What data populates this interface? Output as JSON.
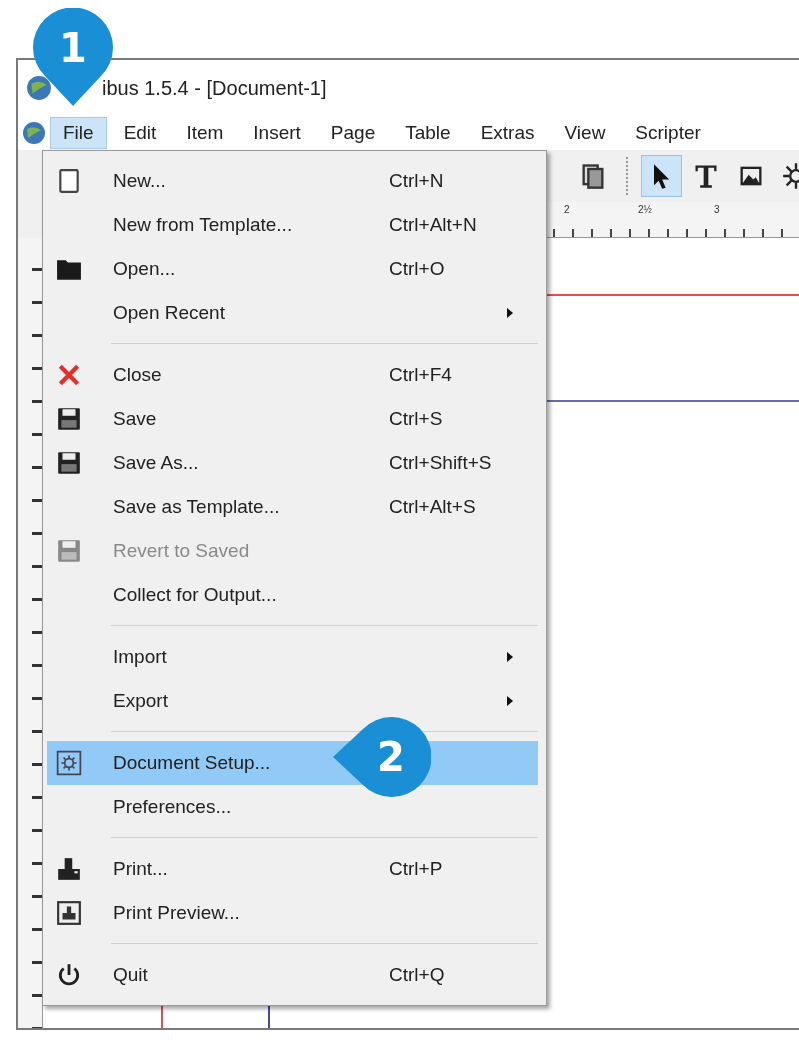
{
  "window": {
    "title": "ibus 1.5.4 - [Document-1]"
  },
  "menu_bar": [
    {
      "label": "File",
      "selected": true
    },
    {
      "label": "Edit",
      "selected": false
    },
    {
      "label": "Item",
      "selected": false
    },
    {
      "label": "Insert",
      "selected": false
    },
    {
      "label": "Page",
      "selected": false
    },
    {
      "label": "Table",
      "selected": false
    },
    {
      "label": "Extras",
      "selected": false
    },
    {
      "label": "View",
      "selected": false
    },
    {
      "label": "Scripter",
      "selected": false
    }
  ],
  "toolbar": [
    {
      "kind": "pages",
      "selected": false
    },
    {
      "kind": "pointer",
      "selected": true
    },
    {
      "kind": "text",
      "selected": false
    },
    {
      "kind": "image",
      "selected": false
    },
    {
      "kind": "shape",
      "selected": false
    }
  ],
  "ruler": {
    "labels": [
      "2",
      "2½",
      "3"
    ]
  },
  "file_menu": [
    [
      {
        "label": "New...",
        "shortcut": "Ctrl+N",
        "kind": "page",
        "submenu": false,
        "disabled": false,
        "selected": false
      },
      {
        "label": "New from Template...",
        "shortcut": "Ctrl+Alt+N",
        "kind": "none",
        "submenu": false,
        "disabled": false,
        "selected": false
      },
      {
        "label": "Open...",
        "shortcut": "Ctrl+O",
        "kind": "folder",
        "submenu": false,
        "disabled": false,
        "selected": false
      },
      {
        "label": "Open Recent",
        "kind": "none",
        "submenu": true,
        "disabled": false,
        "selected": false
      }
    ],
    [
      {
        "label": "Close",
        "shortcut": "Ctrl+F4",
        "kind": "cross",
        "submenu": false,
        "disabled": false,
        "selected": false
      },
      {
        "label": "Save",
        "shortcut": "Ctrl+S",
        "kind": "disk",
        "submenu": false,
        "disabled": false,
        "selected": false
      },
      {
        "label": "Save As...",
        "shortcut": "Ctrl+Shift+S",
        "kind": "disk",
        "submenu": false,
        "disabled": false,
        "selected": false
      },
      {
        "label": "Save as Template...",
        "shortcut": "Ctrl+Alt+S",
        "kind": "none",
        "submenu": false,
        "disabled": false,
        "selected": false
      },
      {
        "label": "Revert to Saved",
        "kind": "disk",
        "submenu": false,
        "disabled": true,
        "selected": false
      },
      {
        "label": "Collect for Output...",
        "kind": "none",
        "submenu": false,
        "disabled": false,
        "selected": false
      }
    ],
    [
      {
        "label": "Import",
        "kind": "none",
        "submenu": true,
        "disabled": false,
        "selected": false
      },
      {
        "label": "Export",
        "kind": "none",
        "submenu": true,
        "disabled": false,
        "selected": false
      }
    ],
    [
      {
        "label": "Document Setup...",
        "kind": "gear",
        "submenu": false,
        "disabled": false,
        "selected": true
      },
      {
        "label": "Preferences...",
        "kind": "none",
        "submenu": false,
        "disabled": false,
        "selected": false
      }
    ],
    [
      {
        "label": "Print...",
        "shortcut": "Ctrl+P",
        "kind": "printer",
        "submenu": false,
        "disabled": false,
        "selected": false
      },
      {
        "label": "Print Preview...",
        "kind": "preview",
        "submenu": false,
        "disabled": false,
        "selected": false
      }
    ],
    [
      {
        "label": "Quit",
        "shortcut": "Ctrl+Q",
        "kind": "power",
        "submenu": false,
        "disabled": false,
        "selected": false
      }
    ]
  ],
  "callouts": [
    {
      "label": "1"
    },
    {
      "label": "2"
    }
  ]
}
